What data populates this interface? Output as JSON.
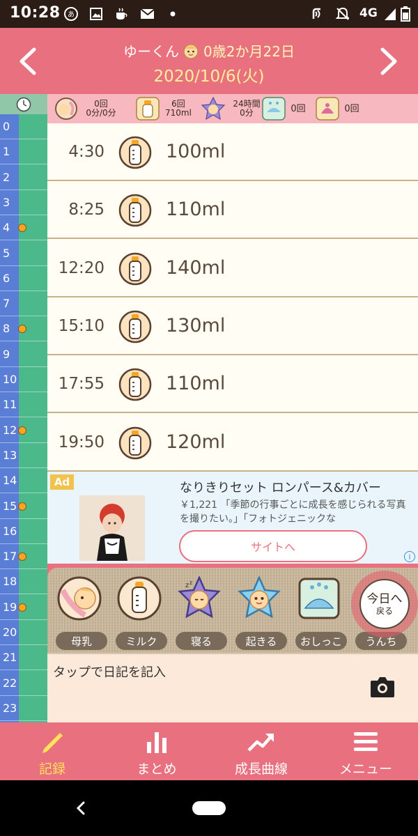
{
  "status_bar": {
    "time": "10:28",
    "network": "4G",
    "icons": [
      "app-notification-icon",
      "image-icon",
      "cup-icon",
      "mail-icon",
      "dot-icon",
      "nfc-icon",
      "mute-icon",
      "signal-icon",
      "battery-icon"
    ]
  },
  "header": {
    "child_name": "ゆーくん",
    "age": "0歳2か月22日",
    "date": "2020/10/6(火)",
    "prev_icon": "chevron-left-icon",
    "next_icon": "chevron-right-icon"
  },
  "summary": {
    "breast": {
      "count": "0回",
      "duration": "0分/0分"
    },
    "milk": {
      "count": "6回",
      "amount": "710ml"
    },
    "sleep": {
      "label": "24時間",
      "duration": "0分"
    },
    "pee": {
      "count": "0回"
    },
    "poop": {
      "count": "0回"
    }
  },
  "timeline_hours": [
    "0",
    "1",
    "2",
    "3",
    "4",
    "5",
    "6",
    "7",
    "8",
    "9",
    "10",
    "11",
    "12",
    "13",
    "14",
    "15",
    "16",
    "17",
    "18",
    "19",
    "20",
    "21",
    "22",
    "23"
  ],
  "timeline_marks": [
    "4",
    "8",
    "12",
    "15",
    "17",
    "19"
  ],
  "records": [
    {
      "time": "4:30",
      "type_icon": "baby-bottle-icon",
      "amount": "100ml"
    },
    {
      "time": "8:25",
      "type_icon": "baby-bottle-icon",
      "amount": "110ml"
    },
    {
      "time": "12:20",
      "type_icon": "baby-bottle-icon",
      "amount": "140ml"
    },
    {
      "time": "15:10",
      "type_icon": "baby-bottle-icon",
      "amount": "130ml"
    },
    {
      "time": "17:55",
      "type_icon": "baby-bottle-icon",
      "amount": "110ml"
    },
    {
      "time": "19:50",
      "type_icon": "baby-bottle-icon",
      "amount": "120ml"
    }
  ],
  "ad": {
    "badge": "Ad",
    "title": "なりきりセット ロンパース&カバー",
    "description": "￥1,221 「季節の行事ごとに成長を感じられる写真を撮りたい。」「フォトジェニックな",
    "cta": "サイトへ",
    "info": "i"
  },
  "actions": [
    {
      "label": "母乳",
      "icon": "breastfeeding-icon"
    },
    {
      "label": "ミルク",
      "icon": "baby-bottle-icon"
    },
    {
      "label": "寝る",
      "icon": "sleeping-baby-icon"
    },
    {
      "label": "起きる",
      "icon": "awake-baby-icon"
    },
    {
      "label": "おしっこ",
      "icon": "pee-icon"
    },
    {
      "label": "うんち",
      "icon": "poop-icon"
    }
  ],
  "today_button": {
    "line1": "今日へ",
    "line2": "戻る"
  },
  "diary": {
    "placeholder": "タップで日記を記入",
    "camera_icon": "camera-icon"
  },
  "bottom_nav": [
    {
      "label": "記録",
      "icon": "pencil-icon",
      "active": true
    },
    {
      "label": "まとめ",
      "icon": "bar-chart-icon",
      "active": false
    },
    {
      "label": "成長曲線",
      "icon": "growth-trend-icon",
      "active": false
    },
    {
      "label": "メニュー",
      "icon": "menu-icon",
      "active": false
    }
  ],
  "colors": {
    "header": "#e8707f",
    "date": "#fff19a",
    "rail_green": "#4bb98a",
    "rail_blue": "#5a7ed6",
    "active_nav": "#ffe25a",
    "list_bg": "#fffdf4"
  }
}
